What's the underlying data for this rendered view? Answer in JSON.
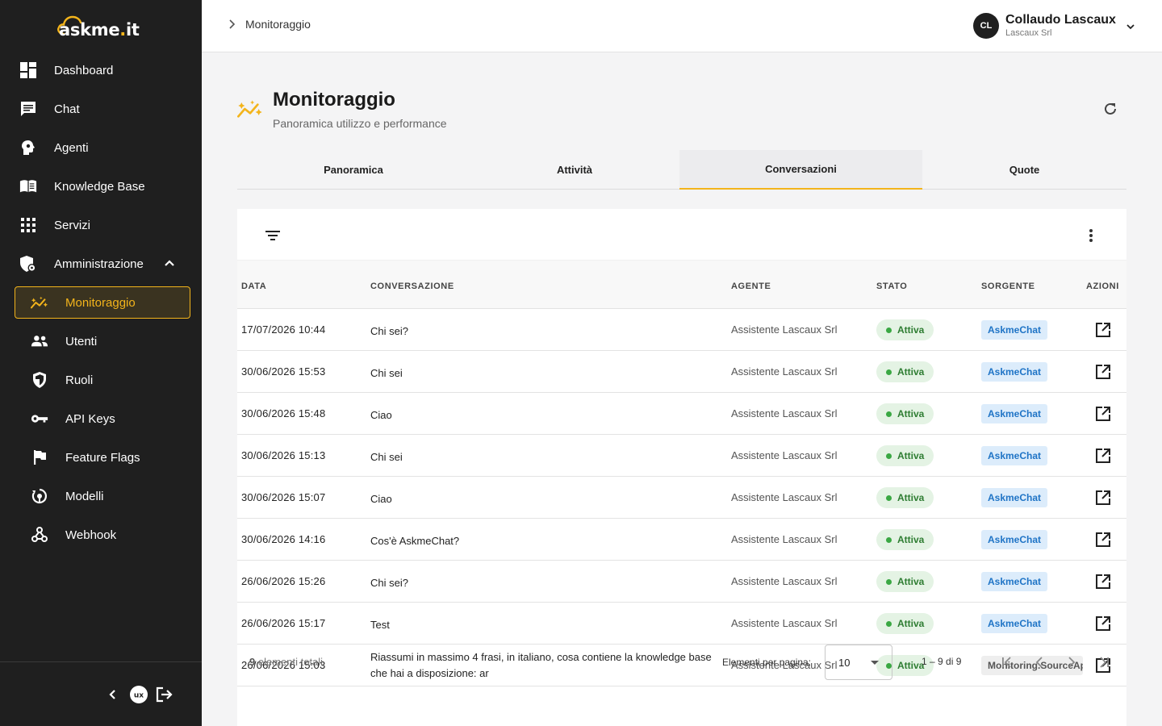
{
  "brand": {
    "name_prefix": "askme",
    "name_dot": ".",
    "name_suffix": "it",
    "accent": "#f3b41b"
  },
  "sidebar": {
    "items": [
      {
        "label": "Dashboard",
        "icon": "dashboard-icon"
      },
      {
        "label": "Chat",
        "icon": "chat-icon"
      },
      {
        "label": "Agenti",
        "icon": "agent-icon"
      },
      {
        "label": "Knowledge Base",
        "icon": "book-icon"
      },
      {
        "label": "Servizi",
        "icon": "apps-grid-icon"
      },
      {
        "label": "Amministrazione",
        "icon": "admin-shield-icon"
      }
    ],
    "sub_items": [
      {
        "label": "Monitoraggio",
        "icon": "monitoring-icon"
      },
      {
        "label": "Utenti",
        "icon": "users-icon"
      },
      {
        "label": "Ruoli",
        "icon": "shield-icon"
      },
      {
        "label": "API Keys",
        "icon": "key-icon"
      },
      {
        "label": "Feature Flags",
        "icon": "flag-icon"
      },
      {
        "label": "Modelli",
        "icon": "model-icon"
      },
      {
        "label": "Webhook",
        "icon": "webhook-icon"
      }
    ],
    "footer_badge": "ux"
  },
  "header": {
    "breadcrumb": "Monitoraggio",
    "user": {
      "initials": "CL",
      "name": "Collaudo Lascaux",
      "org": "Lascaux Srl"
    }
  },
  "page": {
    "title": "Monitoraggio",
    "subtitle": "Panoramica utilizzo e performance"
  },
  "tabs": [
    {
      "label": "Panoramica"
    },
    {
      "label": "Attività"
    },
    {
      "label": "Conversazioni"
    },
    {
      "label": "Quote"
    }
  ],
  "table": {
    "columns": {
      "date": "DATA",
      "conversation": "CONVERSAZIONE",
      "agent": "AGENTE",
      "status": "STATO",
      "source": "SORGENTE",
      "actions": "AZIONI"
    },
    "rows": [
      {
        "date": "17/07/2026 10:44",
        "conversation": "Chi sei?",
        "agent": "Assistente Lascaux Srl",
        "status": "Attiva",
        "source": "AskmeChat"
      },
      {
        "date": "30/06/2026 15:53",
        "conversation": "Chi sei",
        "agent": "Assistente Lascaux Srl",
        "status": "Attiva",
        "source": "AskmeChat"
      },
      {
        "date": "30/06/2026 15:48",
        "conversation": "Ciao",
        "agent": "Assistente Lascaux Srl",
        "status": "Attiva",
        "source": "AskmeChat"
      },
      {
        "date": "30/06/2026 15:13",
        "conversation": "Chi sei",
        "agent": "Assistente Lascaux Srl",
        "status": "Attiva",
        "source": "AskmeChat"
      },
      {
        "date": "30/06/2026 15:07",
        "conversation": "Ciao",
        "agent": "Assistente Lascaux Srl",
        "status": "Attiva",
        "source": "AskmeChat"
      },
      {
        "date": "30/06/2026 14:16",
        "conversation": "Cos'è AskmeChat?",
        "agent": "Assistente Lascaux Srl",
        "status": "Attiva",
        "source": "AskmeChat"
      },
      {
        "date": "26/06/2026 15:26",
        "conversation": "Chi sei?",
        "agent": "Assistente Lascaux Srl",
        "status": "Attiva",
        "source": "AskmeChat"
      },
      {
        "date": "26/06/2026 15:17",
        "conversation": "Test",
        "agent": "Assistente Lascaux Srl",
        "status": "Attiva",
        "source": "AskmeChat"
      },
      {
        "date": "26/06/2026 15:03",
        "conversation": "Riassumi in massimo 4 frasi, in italiano, cosa contiene la knowledge base che hai a disposizione: ar",
        "agent": "Assistente Lascaux Srl",
        "status": "Attiva",
        "source": "Monitoring.SourceApi"
      }
    ]
  },
  "pagination": {
    "total_count": "9",
    "total_label": "elementi totali",
    "per_page_label": "Elementi per pagina:",
    "per_page_value": "10",
    "range": "1 – 9 di 9"
  },
  "colors": {
    "sidebar_bg": "#1f1f1f",
    "accent": "#f3b41b",
    "status_green": "#2e7d32",
    "source_blue": "#1f74c6"
  }
}
